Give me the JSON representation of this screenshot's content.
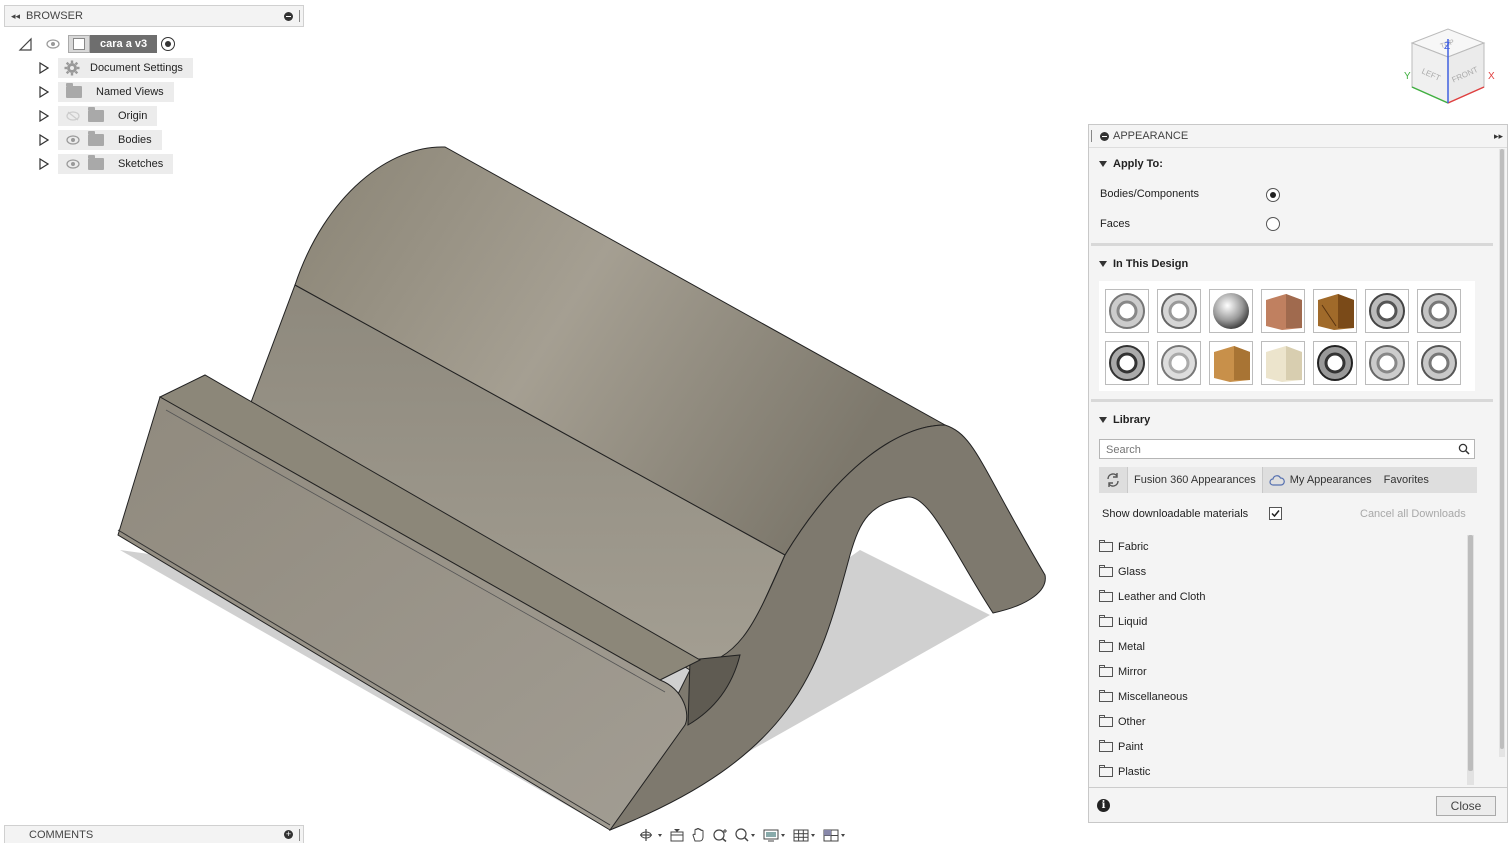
{
  "browser": {
    "title": "BROWSER",
    "root": {
      "label": "cara a v3"
    },
    "items": [
      {
        "label": "Document Settings",
        "icon": "gear-icon"
      },
      {
        "label": "Named Views",
        "icon": "folder-icon"
      },
      {
        "label": "Origin",
        "icon": "folder-icon"
      },
      {
        "label": "Bodies",
        "icon": "folder-icon"
      },
      {
        "label": "Sketches",
        "icon": "folder-icon"
      }
    ]
  },
  "comments": {
    "title": "COMMENTS"
  },
  "viewcube": {
    "top": "TOP",
    "left": "LEFT",
    "front": "FRONT",
    "axis_x": "X",
    "axis_y": "Y",
    "axis_z": "Z"
  },
  "appearance": {
    "title": "APPEARANCE",
    "apply_to": {
      "title": "Apply To:",
      "options": [
        {
          "label": "Bodies/Components",
          "selected": true
        },
        {
          "label": "Faces",
          "selected": false
        }
      ]
    },
    "in_design": {
      "title": "In This Design",
      "swatches": [
        "chrome-ring",
        "chrome-ring",
        "chrome-sphere",
        "copper-cube",
        "wood-cube",
        "chrome-ring",
        "chrome-ring",
        "dark-ring",
        "chrome-ring",
        "oak-cube",
        "light-wood-cube",
        "dark-ring",
        "chrome-ring",
        "chrome-ring"
      ]
    },
    "library": {
      "title": "Library",
      "search_placeholder": "Search",
      "tabs": {
        "fusion": "Fusion 360 Appearances",
        "mine": "My Appearances",
        "favorites": "Favorites"
      },
      "show_downloadable": "Show downloadable materials",
      "show_downloadable_checked": true,
      "cancel_downloads": "Cancel all Downloads",
      "categories": [
        "Fabric",
        "Glass",
        "Leather and Cloth",
        "Liquid",
        "Metal",
        "Mirror",
        "Miscellaneous",
        "Other",
        "Paint",
        "Plastic"
      ]
    },
    "close_label": "Close"
  }
}
